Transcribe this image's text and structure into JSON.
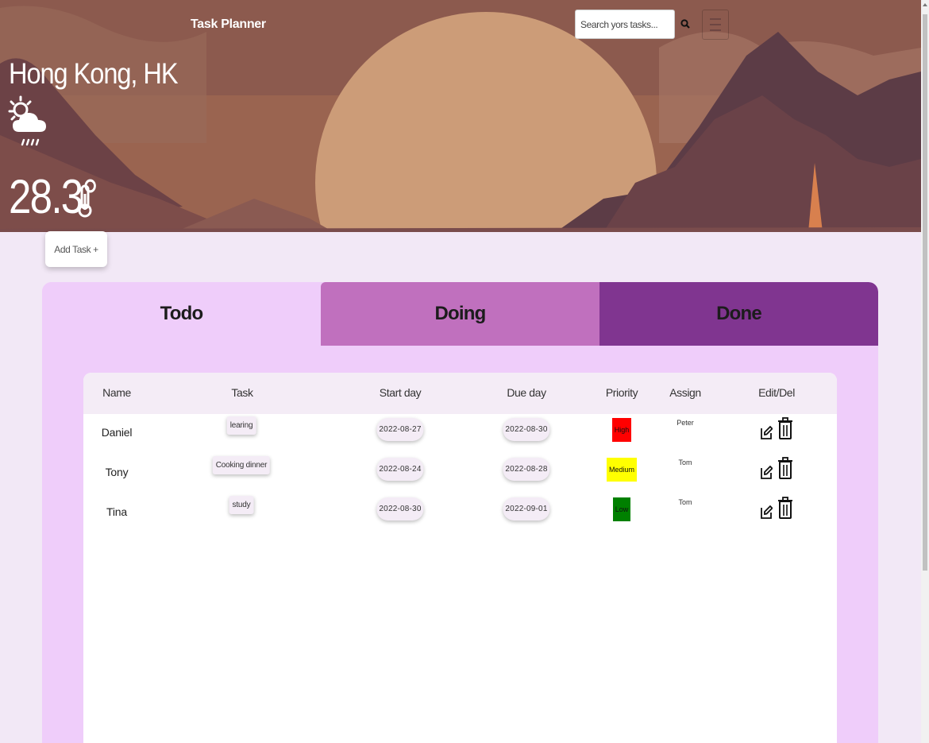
{
  "header": {
    "title": "Task Planner",
    "search": {
      "placeholder": "Search yors tasks...",
      "value": ""
    },
    "search_icon": "search-icon",
    "menu_icon": "hamburger-menu-icon"
  },
  "weather": {
    "city": "Hong Kong, HK",
    "icon": "sun-cloud-rain-icon",
    "temperature": "28.3°",
    "temp_icon": "thermometer-icon"
  },
  "add_task_label": "Add Task +",
  "tabs": [
    {
      "label": "Todo",
      "color": "#efcdfa"
    },
    {
      "label": "Doing",
      "color": "#c070be"
    },
    {
      "label": "Done",
      "color": "#803590"
    }
  ],
  "table": {
    "columns": [
      "Name",
      "Task",
      "Start day",
      "Due day",
      "Priority",
      "Assign",
      "Edit/Del"
    ],
    "rows": [
      {
        "name": "Daniel",
        "task": "learing",
        "start": "2022-08-27",
        "due": "2022-08-30",
        "priority": "High",
        "priority_color": "#ff0000",
        "assign": "Peter"
      },
      {
        "name": "Tony",
        "task": "Cooking dinner",
        "start": "2022-08-24",
        "due": "2022-08-28",
        "priority": "Medium",
        "priority_color": "#ffff00",
        "assign": "Tom"
      },
      {
        "name": "Tina",
        "task": "study",
        "start": "2022-08-30",
        "due": "2022-09-01",
        "priority": "Low",
        "priority_color": "#008000",
        "assign": "Tom"
      }
    ],
    "edit_icon": "pencil-edit-icon",
    "delete_icon": "trash-icon"
  }
}
